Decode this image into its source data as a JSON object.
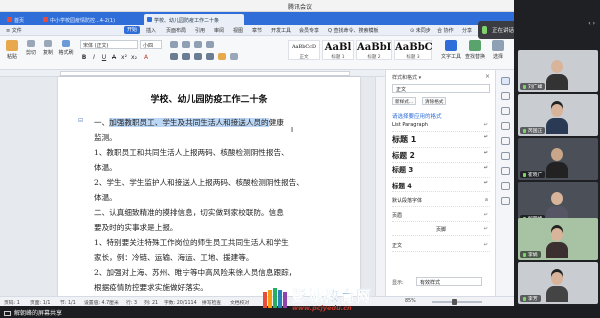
{
  "meeting": {
    "title": "腾讯会议",
    "window_controls": [
      "—",
      "□",
      "✕"
    ],
    "speaking_label": "正在讲话: 解朝峻",
    "bottom_share_label": "解朝峰的屏幕共享"
  },
  "wps": {
    "tabs": [
      {
        "label": "首页",
        "active": false
      },
      {
        "label": "中小学校园疫情防控...4-2(1)",
        "active": false
      },
      {
        "label": "学校、幼儿园防疫工作二十条",
        "active": true
      }
    ],
    "menu": [
      "≡ 文件",
      "开始",
      "插入",
      "页面布局",
      "引用",
      "审阅",
      "视图",
      "章节",
      "开发工具",
      "会员专享",
      "Q 查找命令、搜索模板",
      "⊙ 未同步",
      "合 协作",
      "分享"
    ],
    "active_menu": "开始",
    "ribbon": {
      "paste": "粘贴",
      "cut": "剪切",
      "copy": "复制",
      "format_painter": "格式刷",
      "font_name": "宋体 (正文)",
      "font_size": "小四",
      "format_buttons": [
        "B",
        "I",
        "U",
        "A",
        "x²",
        "x₂",
        "A"
      ],
      "styles": [
        {
          "sample": "AaBbCcD",
          "name": "正文"
        },
        {
          "sample": "AaBl",
          "name": "标题 1"
        },
        {
          "sample": "AaBbI",
          "name": "标题 2"
        },
        {
          "sample": "AaBbC",
          "name": "标题 3"
        }
      ],
      "right_buttons": [
        "文字工具",
        "查找替换",
        "选择"
      ]
    },
    "document": {
      "title": "学校、幼儿园防疫工作二十条",
      "lines": [
        {
          "pre": "一、",
          "highlight": "加强教职员工、学生及共同生活人和接送人员的",
          "post": "健康"
        },
        {
          "pre": "监测。",
          "highlight": "",
          "post": ""
        },
        {
          "pre": "1、教职员工和共同生活人上报两码、核酸检测阴性报告、",
          "highlight": "",
          "post": ""
        },
        {
          "pre": "体温。",
          "highlight": "",
          "post": ""
        },
        {
          "pre": "2、学生、学生监护人和接送人上报两码、核酸检测阴性报告、",
          "highlight": "",
          "post": ""
        },
        {
          "pre": "体温。",
          "highlight": "",
          "post": ""
        },
        {
          "pre": "二、认真细致精准的摸排信息，切实做到家校联防。信息",
          "highlight": "",
          "post": ""
        },
        {
          "pre": "要及时的实事求是上报。",
          "highlight": "",
          "post": ""
        },
        {
          "pre": "1、特别要关注特殊工作岗位的师生员工共同生活人和学生",
          "highlight": "",
          "post": ""
        },
        {
          "pre": "家长，例：冷链、运输、海运、工地、援建等。",
          "highlight": "",
          "post": ""
        },
        {
          "pre": "2、加强对上海、苏州、睢宁等中高风险来徐人员信息跟踪，",
          "highlight": "",
          "post": ""
        },
        {
          "pre": "根据疫情防控要求实施做好落实。",
          "highlight": "",
          "post": ""
        }
      ]
    },
    "style_panel": {
      "header": "样式和格式 ▾",
      "close": "×",
      "current": "正文",
      "buttons": [
        "新样式...",
        "清除格式"
      ],
      "link": "请选择要应用的格式",
      "styles": [
        {
          "label": "List Paragraph",
          "mark": "↵"
        },
        {
          "label": "标题 1",
          "mark": "↵"
        },
        {
          "label": "标题 2",
          "mark": "↵"
        },
        {
          "label": "标题 3",
          "mark": "↵"
        },
        {
          "label": "标题 4",
          "mark": "↵"
        },
        {
          "label": "默认段落字体",
          "mark": "a"
        },
        {
          "label": "页眉",
          "mark": "↵"
        },
        {
          "label": "页脚",
          "mark": "↵"
        },
        {
          "label": "正文",
          "mark": "↵"
        }
      ],
      "show_label": "显示:",
      "show_value": "有效样式"
    },
    "status": {
      "page": "页码: 1",
      "pages": "页面: 1/1",
      "section": "节: 1/1",
      "setting": "设置值: 4.7厘米",
      "row": "行: 3",
      "col": "列: 21",
      "words": "字数: 20/1114",
      "spell": "拼写检查",
      "proof": "文档校对",
      "zoom": "85%",
      "zoom_level": 0.45
    }
  },
  "participants": [
    {
      "name": "刘广峰",
      "camera": "room"
    },
    {
      "name": "芮国正",
      "camera": "room"
    },
    {
      "name": "崔晓广",
      "camera": "dark"
    },
    {
      "name": "解朝峰",
      "camera": "dark"
    },
    {
      "name": "李娟",
      "camera": "green"
    },
    {
      "name": "李芳",
      "camera": "room"
    }
  ],
  "watermark": {
    "title": "彭城教育网",
    "url": "www.pcjyedu.cn"
  }
}
